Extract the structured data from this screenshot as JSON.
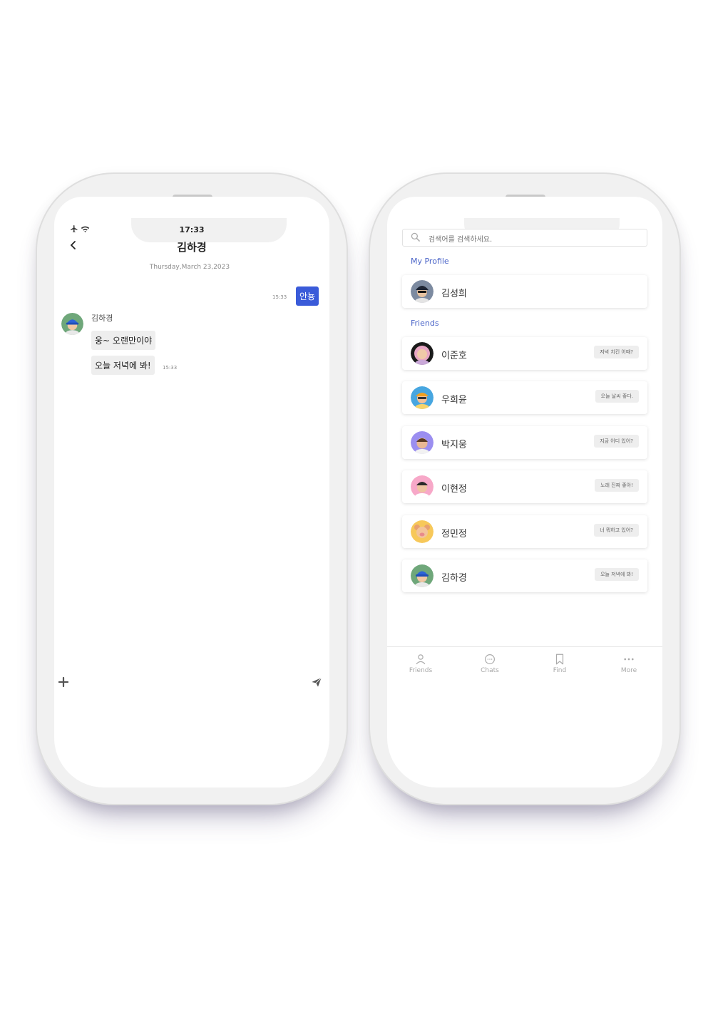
{
  "chat_screen": {
    "status_time": "17:33",
    "title": "김하경",
    "date": "Thursday,March 23,2023",
    "sent": {
      "text": "안뇽",
      "time": "15:33"
    },
    "sender_name": "김하경",
    "received": [
      {
        "text": "웅~ 오랜만이야"
      },
      {
        "text": "오늘 저녁에 봐!",
        "time": "15:33"
      }
    ],
    "colors": {
      "accent": "#3a5bd9",
      "bubble": "#eeeeee"
    },
    "icons": [
      "airplane-icon",
      "wifi-icon",
      "back-arrow-icon",
      "plus-icon",
      "send-icon"
    ]
  },
  "friends_screen": {
    "search_placeholder": "검색어를 검색하세요.",
    "my_profile_label": "My Profile",
    "my_profile": {
      "name": "김성희"
    },
    "friends_label": "Friends",
    "friends": [
      {
        "name": "이준호",
        "status": "저녁 치킨 어때?"
      },
      {
        "name": "우희윤",
        "status": "오늘 날씨 좋다."
      },
      {
        "name": "박지웅",
        "status": "지금 어디 있어?"
      },
      {
        "name": "이현정",
        "status": "노래 진짜 좋아!"
      },
      {
        "name": "정민정",
        "status": "너 뭐하고 있어?"
      },
      {
        "name": "김하경",
        "status": "오늘 저녁에 봐!"
      }
    ],
    "tabs": [
      {
        "label": "Friends",
        "icon": "person-icon"
      },
      {
        "label": "Chats",
        "icon": "chat-bubble-icon"
      },
      {
        "label": "Find",
        "icon": "bookmark-icon"
      },
      {
        "label": "More",
        "icon": "more-dots-icon"
      }
    ],
    "colors": {
      "section_label": "#4a64c8",
      "tab_inactive": "#a8a8a8"
    }
  }
}
